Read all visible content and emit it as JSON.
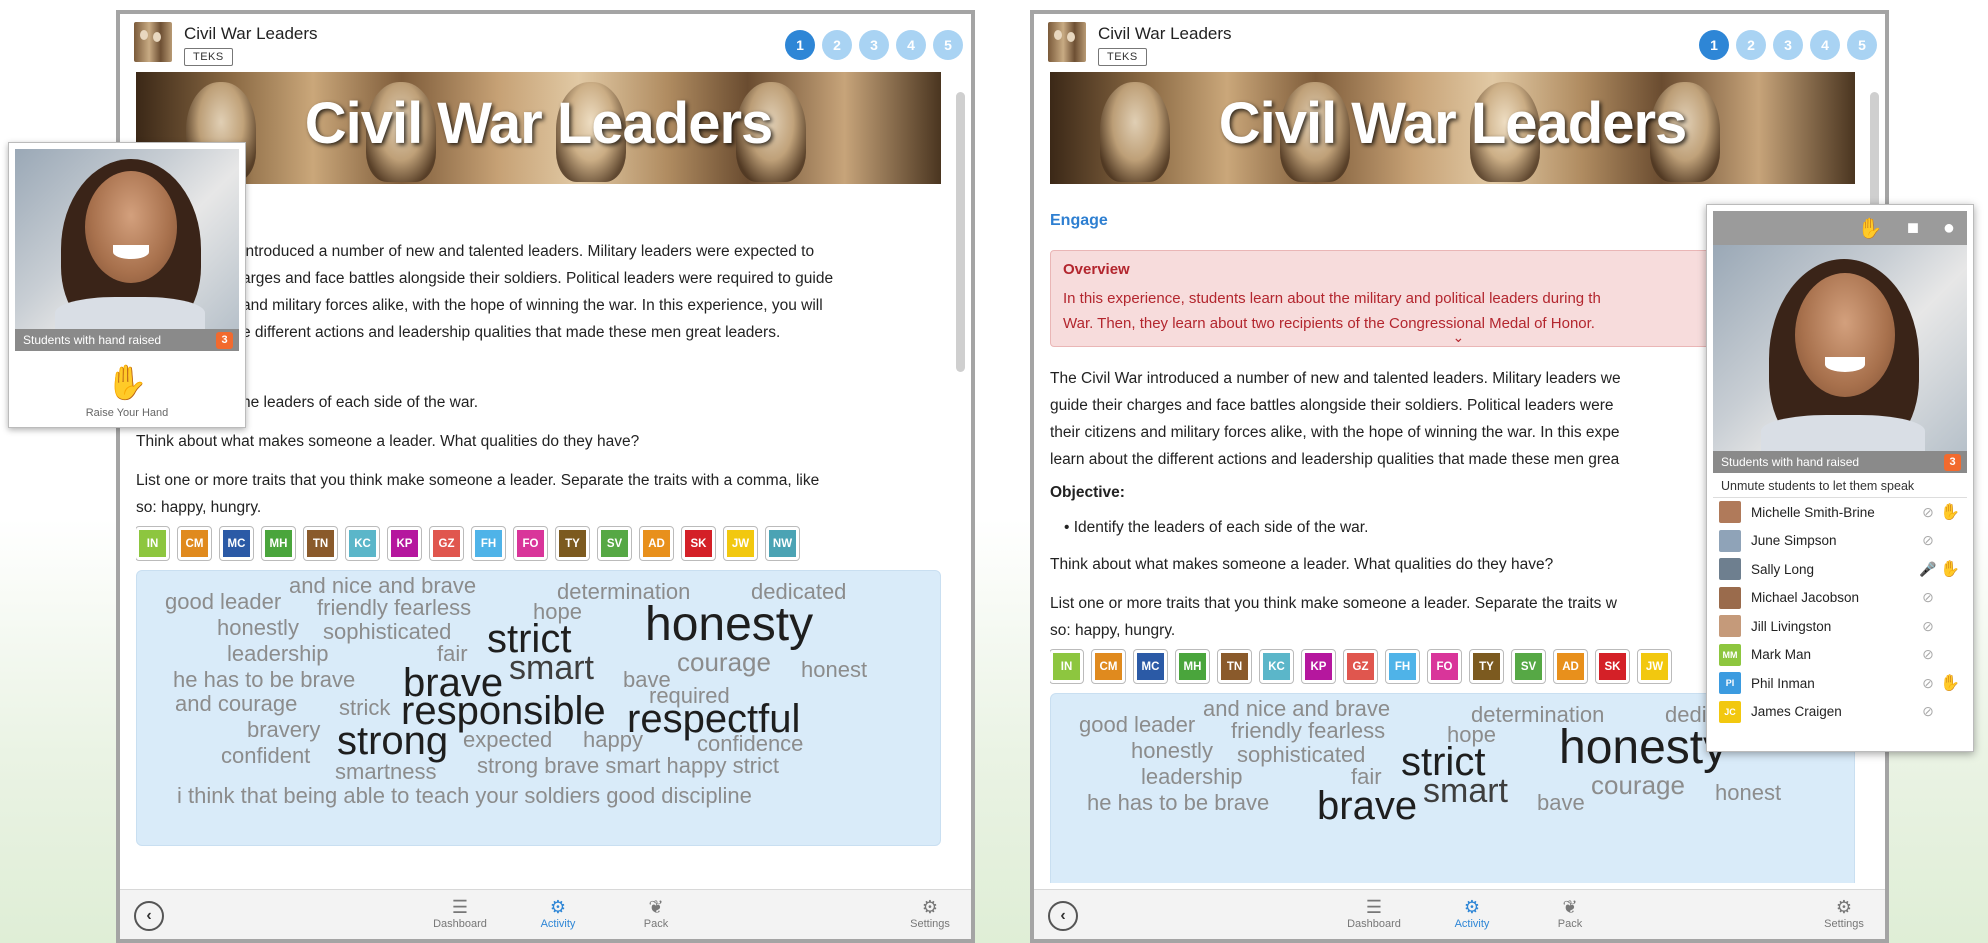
{
  "app": {
    "title": "Civil War Leaders",
    "badge": "TEKS",
    "steps": [
      "1",
      "2",
      "3",
      "4",
      "5"
    ],
    "banner_title": "Civil War Leaders"
  },
  "left": {
    "intro": "introduced a number of new and talented leaders. Military leaders were expected to",
    "intro2": "arges and face battles alongside their soldiers. Political leaders were required to guide",
    "intro3": "and military forces alike, with the hope of winning the war. In this experience, you will",
    "intro4": "e different actions and leadership qualities that made these men great leaders.",
    "objective": "he leaders of each side of the war.",
    "think": "Think about what makes someone a leader. What qualities do they have?",
    "list1": "List one or more traits that you think make someone a leader. Separate the traits with a comma, like",
    "list2": "so: happy, hungry."
  },
  "right": {
    "engage": "Engage",
    "overview_title": "Overview",
    "overview_1": "In this experience, students learn about the military and political leaders during th",
    "overview_2": "War. Then, they learn about two recipients of the Congressional Medal of Honor.",
    "overview_chevron": "⌄",
    "p1": "The Civil War introduced a number of new and talented leaders. Military leaders we",
    "p2": "guide their charges and face battles alongside their soldiers. Political leaders were",
    "p3": "their citizens and military forces alike, with the hope of winning the war. In this expe",
    "p4": "learn about the different actions and leadership qualities that made these men grea",
    "objective_label": "Objective:",
    "objective_item": "Identify the leaders of each side of the war.",
    "think": "Think about what makes someone a leader. What qualities do they have?",
    "list1": "List one or more traits that you think make someone a leader. Separate the traits w",
    "list2": "so: happy, hungry."
  },
  "tags": [
    {
      "code": "IN",
      "color": "#8dc63f"
    },
    {
      "code": "CM",
      "color": "#e08a1e"
    },
    {
      "code": "MC",
      "color": "#2b5aa6"
    },
    {
      "code": "MH",
      "color": "#4aa53c"
    },
    {
      "code": "TN",
      "color": "#8a5a2b"
    },
    {
      "code": "KC",
      "color": "#5bb6c9"
    },
    {
      "code": "KP",
      "color": "#b5179e"
    },
    {
      "code": "GZ",
      "color": "#e0564e"
    },
    {
      "code": "FH",
      "color": "#4fb3e8"
    },
    {
      "code": "FO",
      "color": "#d9359a"
    },
    {
      "code": "TY",
      "color": "#7c5a1f"
    },
    {
      "code": "SV",
      "color": "#56a845"
    },
    {
      "code": "AD",
      "color": "#e8901c"
    },
    {
      "code": "SK",
      "color": "#d42027"
    },
    {
      "code": "JW",
      "color": "#f2c80f"
    },
    {
      "code": "NW",
      "color": "#4ba3b4"
    }
  ],
  "cloud": {
    "and_nice": "and nice and brave",
    "determination": "determination",
    "dedicated": "dedicated",
    "good_leader": "good leader",
    "friendly_fearless": "friendly fearless",
    "hope": "hope",
    "honesty": "honesty",
    "honestly": "honestly",
    "sophisticated": "sophisticated",
    "strict": "strict",
    "leadership": "leadership",
    "fair": "fair",
    "smart": "smart",
    "courage": "courage",
    "honest": "honest",
    "he_has": "he has to be brave",
    "brave": "brave",
    "bave": "bave",
    "required": "required",
    "and_courage": "and courage",
    "strick": "strick",
    "responsible": "responsible",
    "respectful": "respectful",
    "bravery": "bravery",
    "strong": "strong",
    "expected": "expected",
    "happy": "happy",
    "confidence": "confidence",
    "confident": "confident",
    "smartness": "smartness",
    "strong_brave": "strong brave smart happy strict",
    "i_think": "i think that being able to teach your soldiers good discipline"
  },
  "footer": {
    "back": "‹",
    "dashboard": "Dashboard",
    "activity": "Activity",
    "pack": "Pack",
    "settings": "Settings"
  },
  "video_left": {
    "hand_raised": "Students with hand raised",
    "count": "3",
    "raise_label": "Raise Your Hand"
  },
  "video_right": {
    "hand_raised": "Students with hand raised",
    "count": "3",
    "unmute_note": "Unmute students to let them speak",
    "students": [
      {
        "name": "Michelle Smith-Brine",
        "initials": "",
        "color": "#b07a5a",
        "mic_on": false,
        "hand": true
      },
      {
        "name": "June Simpson",
        "initials": "",
        "color": "#8fa3b8",
        "mic_on": false,
        "hand": false
      },
      {
        "name": "Sally Long",
        "initials": "",
        "color": "#6e7f8f",
        "mic_on": true,
        "hand": true
      },
      {
        "name": "Michael Jacobson",
        "initials": "",
        "color": "#9a6b4c",
        "mic_on": false,
        "hand": false
      },
      {
        "name": "Jill Livingston",
        "initials": "",
        "color": "#c59a7a",
        "mic_on": false,
        "hand": false
      },
      {
        "name": "Mark Man",
        "initials": "MM",
        "color": "#8dc63f",
        "mic_on": false,
        "hand": false
      },
      {
        "name": "Phil Inman",
        "initials": "PI",
        "color": "#3b9be0",
        "mic_on": false,
        "hand": true
      },
      {
        "name": "James Craigen",
        "initials": "JC",
        "color": "#f2c80f",
        "mic_on": false,
        "hand": false
      }
    ]
  }
}
